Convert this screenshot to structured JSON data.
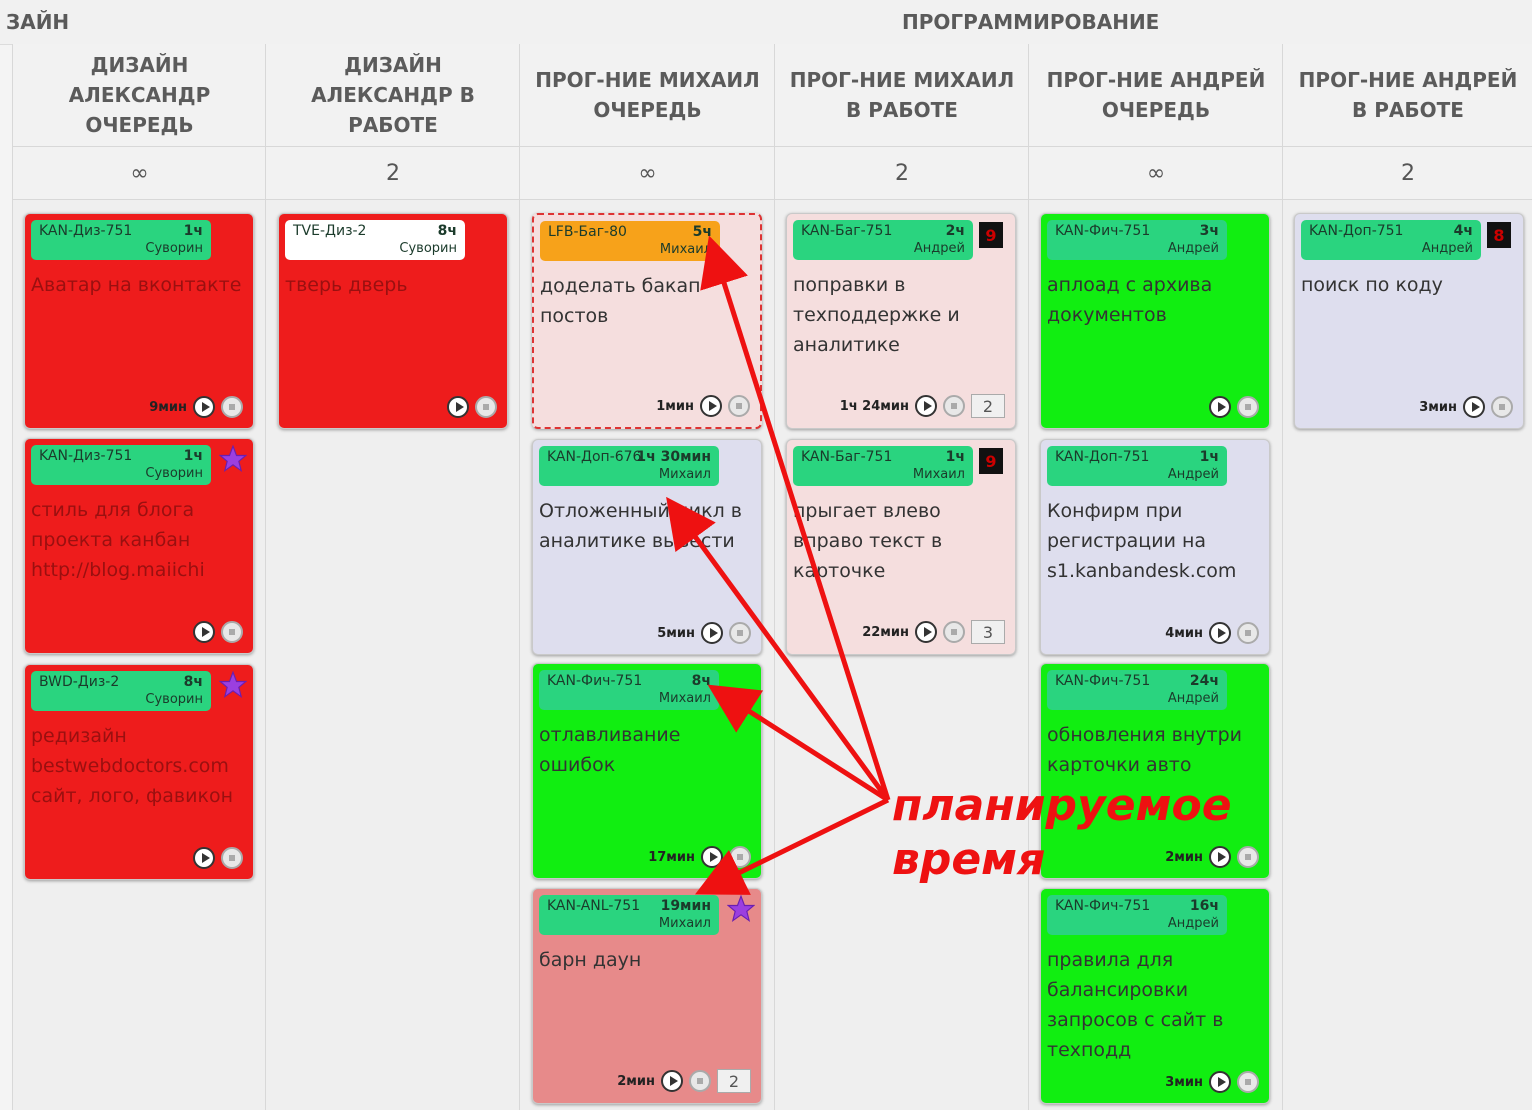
{
  "sections": [
    {
      "id": "design",
      "label": "ЗАЙН"
    },
    {
      "id": "prog",
      "label": "ПРОГРАММИРОВАНИЕ"
    }
  ],
  "columns": [
    {
      "id": "c1",
      "title": "ДИЗАЙН АЛЕКСАНДР ОЧЕРЕДЬ",
      "limit": "∞"
    },
    {
      "id": "c2",
      "title": "ДИЗАЙН АЛЕКСАНДР В РАБОТЕ",
      "limit": "2"
    },
    {
      "id": "c3",
      "title": "ПРОГ-НИЕ МИХАИЛ ОЧЕРЕДЬ",
      "limit": "∞"
    },
    {
      "id": "c4",
      "title": "ПРОГ-НИЕ МИХАИЛ В РАБОТЕ",
      "limit": "2"
    },
    {
      "id": "c5",
      "title": "ПРОГ-НИЕ АНДРЕЙ ОЧЕРЕДЬ",
      "limit": "∞"
    },
    {
      "id": "c6",
      "title": "ПРОГ-НИЕ АНДРЕЙ В РАБОТЕ",
      "limit": "2"
    }
  ],
  "colors": {
    "red": "#ee1c1c",
    "green": "#11ee11",
    "lavender": "#dedeee",
    "pink": "#f5dede",
    "rose": "#e78a8a",
    "orange_tag": "#f7a21a",
    "white_tag": "#ffffff",
    "tag_green": "#2ad47f",
    "annotation": "#ee1111"
  },
  "cards": {
    "c1a": {
      "code": "KAN-Диз-751",
      "estimate": "1ч",
      "assignee": "Суворин",
      "title": "Аватар на вконтакте",
      "elapsed": "9мин",
      "color": "red"
    },
    "c1b": {
      "code": "KAN-Диз-751",
      "estimate": "1ч",
      "assignee": "Суворин",
      "title": "стиль для блога проекта канбан http://blog.maiichi",
      "elapsed": "",
      "color": "red",
      "icon": "star-icon"
    },
    "c1c": {
      "code": "BWD-Диз-2",
      "estimate": "8ч",
      "assignee": "Суворин",
      "title": "редизайн bestwebdoctors.com сайт, лого, фавикон",
      "elapsed": "",
      "color": "red",
      "icon": "star-icon"
    },
    "c2a": {
      "code": "TVE-Диз-2",
      "estimate": "8ч",
      "assignee": "Суворин",
      "title": "тверь дверь",
      "elapsed": "",
      "color": "red"
    },
    "c3a": {
      "code": "LFB-Баг-80",
      "estimate": "5ч",
      "assignee": "Михаил",
      "title": "доделать бакап постов",
      "elapsed": "1мин",
      "color": "pink"
    },
    "c3b": {
      "code": "KAN-Доп-676",
      "estimate": "1ч 30мин",
      "assignee": "Михаил",
      "title": "Отложенный цикл в аналитике вывести",
      "elapsed": "5мин",
      "color": "lavender"
    },
    "c3c": {
      "code": "KAN-Фич-751",
      "estimate": "8ч",
      "assignee": "Михаил",
      "title": "отлавливание ошибок",
      "elapsed": "17мин",
      "color": "green"
    },
    "c3d": {
      "code": "KAN-ANL-751",
      "estimate": "19мин",
      "assignee": "Михаил",
      "title": "барн даун",
      "elapsed": "2мин",
      "color": "rose",
      "badge": "2",
      "icon": "star-icon"
    },
    "c4a": {
      "code": "KAN-Баг-751",
      "estimate": "2ч",
      "assignee": "Андрей",
      "title": "поправки в техподдержке и аналитике",
      "elapsed": "1ч 24мин",
      "color": "pink",
      "badge": "2",
      "blocker": "9"
    },
    "c4b": {
      "code": "KAN-Баг-751",
      "estimate": "1ч",
      "assignee": "Михаил",
      "title": "прыгает влево вправо текст в карточке",
      "elapsed": "22мин",
      "color": "pink",
      "badge": "3",
      "blocker": "9"
    },
    "c5a": {
      "code": "KAN-Фич-751",
      "estimate": "3ч",
      "assignee": "Андрей",
      "title": "аплоад с архива документов",
      "elapsed": "",
      "color": "green"
    },
    "c5b": {
      "code": "KAN-Доп-751",
      "estimate": "1ч",
      "assignee": "Андрей",
      "title": "Конфирм при регистрации на s1.kanbandesk.com",
      "elapsed": "4мин",
      "color": "lavender"
    },
    "c5c": {
      "code": "KAN-Фич-751",
      "estimate": "24ч",
      "assignee": "Андрей",
      "title": "обновления внутри карточки авто",
      "elapsed": "2мин",
      "color": "green"
    },
    "c5d": {
      "code": "KAN-Фич-751",
      "estimate": "16ч",
      "assignee": "Андрей",
      "title": "правила для балансировки запросов с сайт в техподд",
      "elapsed": "3мин",
      "color": "green"
    },
    "c6a": {
      "code": "KAN-Доп-751",
      "estimate": "4ч",
      "assignee": "Андрей",
      "title": "поиск по коду",
      "elapsed": "3мин",
      "color": "lavender",
      "blocker": "8"
    }
  },
  "annotation": {
    "line1": "планируемое",
    "line2": "время"
  }
}
